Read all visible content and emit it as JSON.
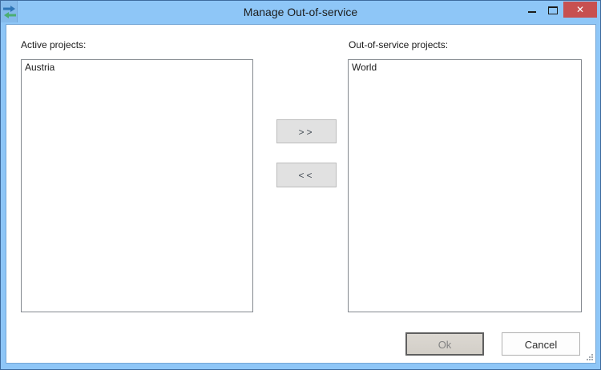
{
  "window": {
    "title": "Manage Out-of-service",
    "app_icon": "transfer-arrows-icon",
    "controls": {
      "minimize_icon": "minimize-dash",
      "maximize_icon": "maximize-square",
      "close_glyph": "✕"
    }
  },
  "active_panel": {
    "label": "Active projects:",
    "items": [
      "Austria"
    ]
  },
  "out_of_service_panel": {
    "label": "Out-of-service projects:",
    "items": [
      "World"
    ]
  },
  "transfer": {
    "move_right": ">>",
    "move_left": "<<"
  },
  "footer": {
    "ok": "Ok",
    "cancel": "Cancel"
  },
  "colors": {
    "titlebar_blue": "#8EC6F7",
    "window_border_blue": "#3E6B9E",
    "close_red": "#C75050",
    "arrow_blue": "#2E75B6",
    "arrow_green": "#4BAE72",
    "listbox_border_gray": "#83888E",
    "ok_border_gray": "#5F5F5F",
    "ok_text_gray": "#838383"
  }
}
